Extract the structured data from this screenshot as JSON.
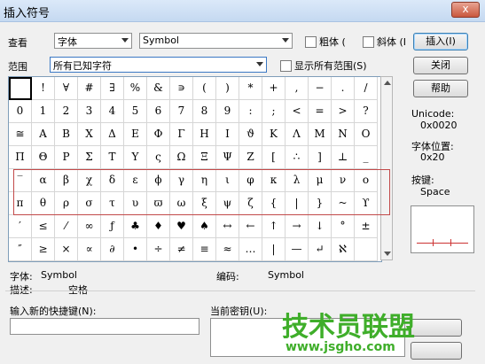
{
  "window": {
    "title": "插入符号",
    "close_label": "x"
  },
  "lookin": {
    "label": "查看",
    "font_value": "字体",
    "symbol_value": "Symbol"
  },
  "style": {
    "bold_label": "粗体 (",
    "italic_label": "斜体 (I"
  },
  "insert_button": "插入(I)",
  "close_button": "关闭",
  "help_button": "帮助",
  "range": {
    "label": "范围",
    "value": "所有已知字符",
    "show_all_label": "显示所有范围(S)"
  },
  "info": {
    "unicode_label": "Unicode:",
    "unicode_value": "0x0020",
    "font_pos_label": "字体位置:",
    "font_pos_value": "0x20",
    "key_label": "按键:",
    "key_value": "Space"
  },
  "grid": {
    "rows": [
      [
        " ",
        "!",
        "∀",
        "#",
        "∃",
        "%",
        "&",
        "∍",
        "(",
        ")",
        "*",
        "+",
        ",",
        "−",
        ".",
        "/"
      ],
      [
        "0",
        "1",
        "2",
        "3",
        "4",
        "5",
        "6",
        "7",
        "8",
        "9",
        ":",
        ";",
        "<",
        "=",
        ">",
        "?"
      ],
      [
        "≅",
        "Α",
        "Β",
        "Χ",
        "Δ",
        "Ε",
        "Φ",
        "Γ",
        "Η",
        "Ι",
        "ϑ",
        "Κ",
        "Λ",
        "Μ",
        "Ν",
        "Ο"
      ],
      [
        "Π",
        "Θ",
        "Ρ",
        "Σ",
        "Τ",
        "Υ",
        "ς",
        "Ω",
        "Ξ",
        "Ψ",
        "Ζ",
        "[",
        "∴",
        "]",
        "⊥",
        "_"
      ],
      [
        "‾",
        "α",
        "β",
        "χ",
        "δ",
        "ε",
        "ϕ",
        "γ",
        "η",
        "ι",
        "φ",
        "κ",
        "λ",
        "μ",
        "ν",
        "ο"
      ],
      [
        "π",
        "θ",
        "ρ",
        "σ",
        "τ",
        "υ",
        "ϖ",
        "ω",
        "ξ",
        "ψ",
        "ζ",
        "{",
        "|",
        "}",
        "~",
        "ϒ"
      ],
      [
        "′",
        "≤",
        "⁄",
        "∞",
        "ƒ",
        "♣",
        "♦",
        "♥",
        "♠",
        "↔",
        "←",
        "↑",
        "→",
        "↓",
        "°",
        "±"
      ],
      [
        "″",
        "≥",
        "×",
        "∝",
        "∂",
        "•",
        "÷",
        "≠",
        "≡",
        "≈",
        "…",
        "|",
        "—",
        "↵",
        "ℵ",
        ""
      ]
    ]
  },
  "details": {
    "font_label": "字体:",
    "font_value": "Symbol",
    "code_label": "编码:",
    "code_value": "Symbol",
    "desc_label": "描述:",
    "desc_value": "空格"
  },
  "shortcut": {
    "new_label": "输入新的快捷键(N):",
    "current_label": "当前密钥(U):"
  },
  "watermark": {
    "main": "技术员联盟",
    "url": "www.jsgho.com"
  },
  "colors": {
    "watermark_green": "#3fae2a",
    "highlight_red": "#c24a4a"
  }
}
